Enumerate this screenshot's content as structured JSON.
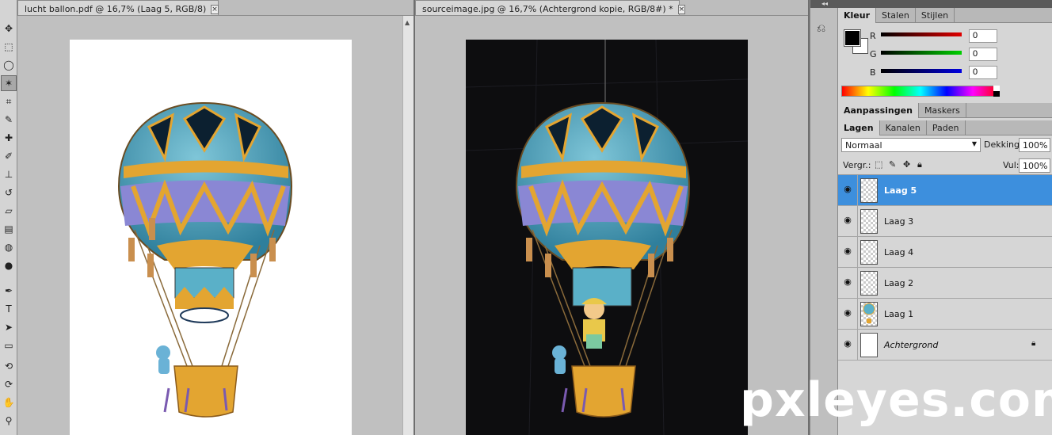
{
  "doc_left": {
    "tab_title": "lucht ballon.pdf @ 16,7% (Laag 5, RGB/8)",
    "close_glyph": "×"
  },
  "doc_right": {
    "tab_title": "sourceimage.jpg @ 16,7% (Achtergrond kopie, RGB/8#) *",
    "close_glyph": "×"
  },
  "color_panel": {
    "tabs": [
      "Kleur",
      "Stalen",
      "Stijlen"
    ],
    "r_label": "R",
    "g_label": "G",
    "b_label": "B",
    "r_value": "0",
    "g_value": "0",
    "b_value": "0",
    "foreground": "#000000",
    "background": "#ffffff"
  },
  "adjust_panel": {
    "tabs": [
      "Aanpassingen",
      "Maskers"
    ]
  },
  "layers_panel": {
    "tabs": [
      "Lagen",
      "Kanalen",
      "Paden"
    ],
    "blend_mode": "Normaal",
    "opacity_label": "Dekking:",
    "opacity_value": "100%",
    "lock_label": "Vergr.:",
    "fill_label": "Vul:",
    "fill_value": "100%",
    "layers": [
      {
        "name": "Laag 5"
      },
      {
        "name": "Laag 3"
      },
      {
        "name": "Laag 4"
      },
      {
        "name": "Laag 2"
      },
      {
        "name": "Laag 1"
      },
      {
        "name": "Achtergrond"
      }
    ]
  },
  "watermark": "pxleyes.com",
  "dock_collapse": "◂◂",
  "colors": {
    "selected_layer": "#3d8fdd",
    "canvas_dark": "#0d0d0f",
    "balloon_top": "#5ab0c8",
    "balloon_yellow": "#e3a531",
    "balloon_purple": "#8a87d4"
  }
}
